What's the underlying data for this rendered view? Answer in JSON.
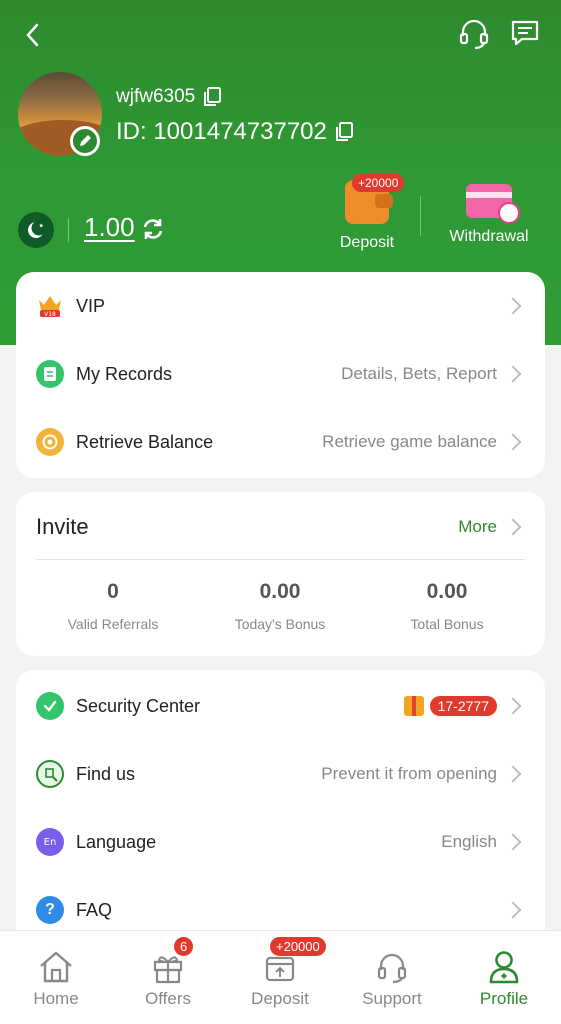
{
  "user": {
    "username": "wjfw6305",
    "id_text": "ID: 1001474737702"
  },
  "wallet": {
    "balance": "1.00"
  },
  "quick_actions": {
    "deposit": {
      "label": "Deposit",
      "badge": "+20000"
    },
    "withdrawal": {
      "label": "Withdrawal"
    }
  },
  "menu_top": {
    "vip": {
      "label": "VIP",
      "badge_text": "V18"
    },
    "records": {
      "label": "My Records",
      "value": "Details, Bets, Report"
    },
    "retrieve": {
      "label": "Retrieve Balance",
      "value": "Retrieve game balance"
    }
  },
  "invite": {
    "title": "Invite",
    "more": "More",
    "stats": [
      {
        "value": "0",
        "caption": "Valid Referrals"
      },
      {
        "value": "0.00",
        "caption": "Today's Bonus"
      },
      {
        "value": "0.00",
        "caption": "Total Bonus"
      }
    ]
  },
  "menu_bottom": {
    "security": {
      "label": "Security Center",
      "badge": "17-2777"
    },
    "findus": {
      "label": "Find us",
      "value": "Prevent it from opening"
    },
    "language": {
      "label": "Language",
      "value": "English",
      "icon_text": "En"
    },
    "faq": {
      "label": "FAQ",
      "icon_text": "?"
    }
  },
  "nav": {
    "home": "Home",
    "offers": "Offers",
    "offers_badge": "6",
    "deposit": "Deposit",
    "deposit_badge": "+20000",
    "support": "Support",
    "profile": "Profile"
  },
  "colors": {
    "brand_green": "#2f9a35",
    "accent_red": "#e03a2e",
    "link_green": "#2c8a2f"
  }
}
